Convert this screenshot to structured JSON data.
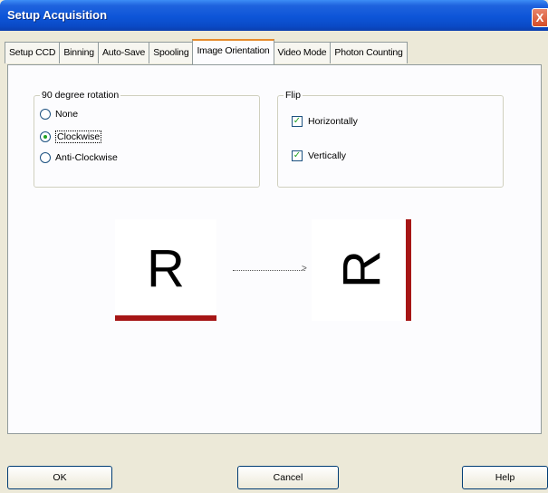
{
  "window": {
    "title": "Setup Acquisition",
    "close_glyph": "X"
  },
  "tabs": [
    {
      "label": "Setup CCD"
    },
    {
      "label": "Binning"
    },
    {
      "label": "Auto-Save"
    },
    {
      "label": "Spooling"
    },
    {
      "label": "Image Orientation",
      "active": true
    },
    {
      "label": "Video Mode"
    },
    {
      "label": "Photon Counting"
    }
  ],
  "rotation": {
    "legend": "90 degree rotation",
    "options": [
      {
        "label": "None",
        "checked": false
      },
      {
        "label": "Clockwise",
        "checked": true
      },
      {
        "label": "Anti-Clockwise",
        "checked": false
      }
    ]
  },
  "flip": {
    "legend": "Flip",
    "options": [
      {
        "label": "Horizontally",
        "checked": true
      },
      {
        "label": "Vertically",
        "checked": true
      }
    ]
  },
  "preview": {
    "source_letter": "R",
    "result_letter": "R",
    "arrow_glyph": ">",
    "accent_color": "#a61616"
  },
  "buttons": {
    "ok": "OK",
    "cancel": "Cancel",
    "help": "Help"
  }
}
